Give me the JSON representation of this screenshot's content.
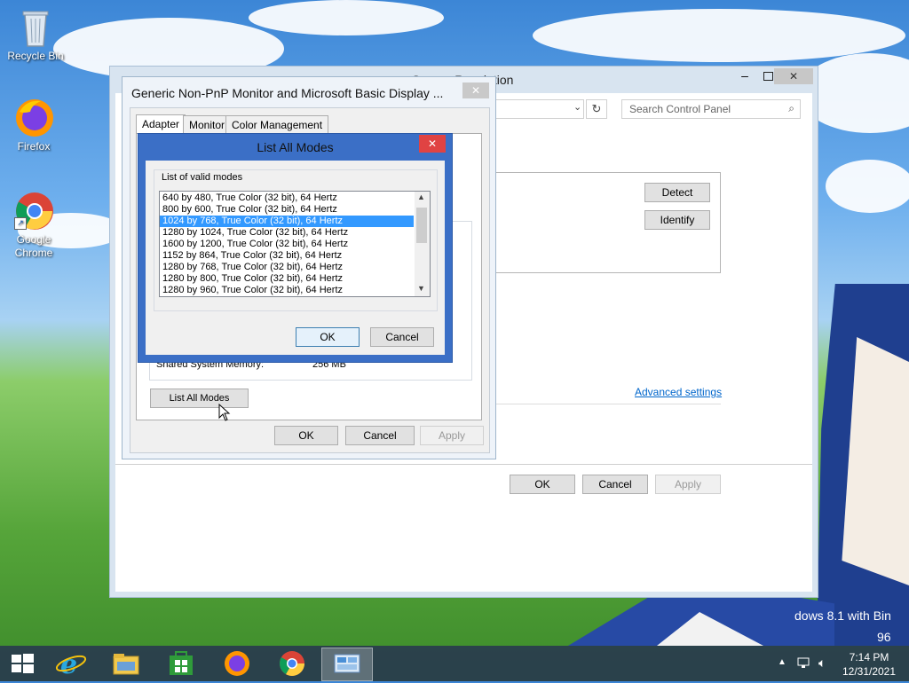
{
  "desktop": {
    "icons": [
      {
        "label": "Recycle Bin"
      },
      {
        "label": "Firefox"
      },
      {
        "label": "Google Chrome"
      }
    ],
    "watermark_line1": "dows 8.1 with Bin",
    "watermark_line2": "96"
  },
  "screen_resolution": {
    "title": "Screen Resolution",
    "search_placeholder": "Search Control Panel",
    "detect_label": "Detect",
    "identify_label": "Identify",
    "advanced_settings": "Advanced settings",
    "ok_label": "OK",
    "cancel_label": "Cancel",
    "apply_label": "Apply"
  },
  "properties": {
    "title": "Generic Non-PnP Monitor and Microsoft Basic Display ...",
    "tabs": [
      "Adapter",
      "Monitor",
      "Color Management"
    ],
    "shared_memory_label": "Shared System Memory:",
    "shared_memory_value": "256 MB",
    "list_all_modes_label": "List All Modes",
    "ok_label": "OK",
    "cancel_label": "Cancel",
    "apply_label": "Apply"
  },
  "list_all_modes": {
    "title": "List All Modes",
    "group_label": "List of valid modes",
    "modes": [
      "640 by 480, True Color (32 bit), 64 Hertz",
      "800 by 600, True Color (32 bit), 64 Hertz",
      "1024 by 768, True Color (32 bit), 64 Hertz",
      "1280 by 1024, True Color (32 bit), 64 Hertz",
      "1600 by 1200, True Color (32 bit), 64 Hertz",
      "1152 by 864, True Color (32 bit), 64 Hertz",
      "1280 by 768, True Color (32 bit), 64 Hertz",
      "1280 by 800, True Color (32 bit), 64 Hertz",
      "1280 by 960, True Color (32 bit), 64 Hertz"
    ],
    "selected_mode": "1024 by 768, True Color (32 bit), 64 Hertz",
    "ok_label": "OK",
    "cancel_label": "Cancel"
  },
  "taskbar": {
    "time": "7:14 PM",
    "date": "12/31/2021"
  },
  "colors": {
    "accent": "#3399ff",
    "dialog_frame": "#3b6fc6",
    "close_red": "#e04343"
  }
}
